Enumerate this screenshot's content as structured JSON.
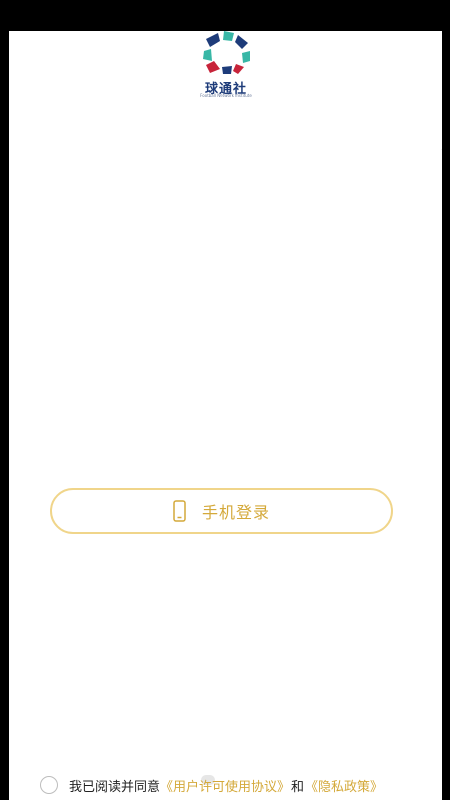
{
  "app": {
    "name": "球通社",
    "subtitle": "Football Network Institute",
    "brand_colors": {
      "navy": "#1e3c7a",
      "teal": "#38b7a6",
      "red": "#c7243a",
      "gold": "#d4a93a"
    }
  },
  "login": {
    "icon": "phone-icon",
    "label": "手机登录"
  },
  "agreement": {
    "prefix": "我已阅读并同意",
    "user_license_link": "《用户许可使用协议》",
    "conjunction": "和",
    "privacy_link": "《隐私政策》",
    "checked": false
  }
}
